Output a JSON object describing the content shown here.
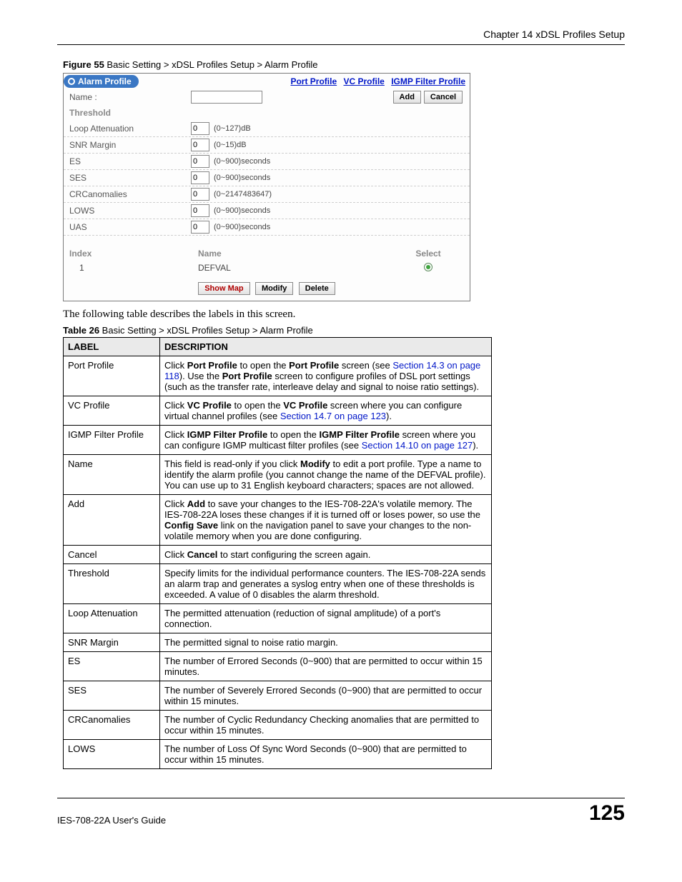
{
  "header": {
    "chapter": "Chapter 14 xDSL Profiles Setup"
  },
  "figure": {
    "label_bold": "Figure 55",
    "label_rest": "   Basic Setting > xDSL Profiles Setup > Alarm Profile"
  },
  "screenshot": {
    "title": "Alarm Profile",
    "links": {
      "port": "Port Profile",
      "vc": "VC Profile",
      "igmp": "IGMP Filter Profile"
    },
    "name_label": "Name :",
    "add_btn": "Add",
    "cancel_btn": "Cancel",
    "threshold_heading": "Threshold",
    "rows": [
      {
        "label": "Loop Attenuation",
        "value": "0",
        "hint": "(0~127)dB"
      },
      {
        "label": "SNR Margin",
        "value": "0",
        "hint": "(0~15)dB"
      },
      {
        "label": "ES",
        "value": "0",
        "hint": "(0~900)seconds"
      },
      {
        "label": "SES",
        "value": "0",
        "hint": "(0~900)seconds"
      },
      {
        "label": "CRCanomalies",
        "value": "0",
        "hint": "(0~2147483647)"
      },
      {
        "label": "LOWS",
        "value": "0",
        "hint": "(0~900)seconds"
      },
      {
        "label": "UAS",
        "value": "0",
        "hint": "(0~900)seconds"
      }
    ],
    "list_headers": {
      "index": "Index",
      "name": "Name",
      "select": "Select"
    },
    "list_row": {
      "index": "1",
      "name": "DEFVAL"
    },
    "bottom_btns": {
      "showmap": "Show Map",
      "modify": "Modify",
      "delete": "Delete"
    }
  },
  "body_text": "The following table describes the labels in this screen.",
  "table_caption": {
    "bold": "Table 26",
    "rest": "   Basic Setting > xDSL Profiles Setup > Alarm Profile"
  },
  "table": {
    "head": {
      "label": "LABEL",
      "desc": "DESCRIPTION"
    },
    "rows": [
      {
        "label": "Port Profile",
        "desc_pre": "Click ",
        "b1": "Port Profile",
        "desc_mid": " to open the ",
        "b2": "Port Profile",
        "desc_post": " screen (see ",
        "xref": "Section 14.3 on page 118",
        "tail": "). Use the ",
        "b3": "Port Profile",
        "tail2": " screen to configure profiles of DSL port settings (such as the transfer rate, interleave delay and signal to noise ratio settings)."
      },
      {
        "label": "VC Profile",
        "desc_pre": "Click ",
        "b1": "VC Profile",
        "desc_mid": " to open the ",
        "b2": "VC Profile",
        "desc_post": " screen where you can configure virtual channel profiles (see ",
        "xref": "Section 14.7 on page 123",
        "tail": ").",
        "b3": "",
        "tail2": ""
      },
      {
        "label": "IGMP Filter Profile",
        "desc_pre": "Click ",
        "b1": "IGMP Filter Profile",
        "desc_mid": " to open the ",
        "b2": "IGMP Filter Profile",
        "desc_post": " screen where you can configure IGMP multicast filter profiles (see ",
        "xref": "Section 14.10 on page 127",
        "tail": ").",
        "b3": "",
        "tail2": ""
      },
      {
        "label": "Name",
        "plain": "This field is read-only if you click ",
        "b1": "Modify",
        "plain2": " to edit a port profile. Type a name to identify the alarm profile (you cannot change the name of the DEFVAL profile). You can use up to 31 English keyboard characters; spaces are not allowed."
      },
      {
        "label": "Add",
        "plain": "Click ",
        "b1": "Add",
        "plain2": " to save your changes to the IES-708-22A's volatile memory. The IES-708-22A loses these changes if it is turned off or loses power, so use the ",
        "b2": "Config Save",
        "plain3": " link on the navigation panel to save your changes to the non-volatile memory when you are done configuring."
      },
      {
        "label": "Cancel",
        "plain": "Click ",
        "b1": "Cancel",
        "plain2": " to start configuring the screen again."
      },
      {
        "label": "Threshold",
        "plainonly": "Specify limits for the individual performance counters. The IES-708-22A sends an alarm trap and generates a syslog entry when one of these thresholds is exceeded. A value of 0 disables the alarm threshold."
      },
      {
        "label": "Loop Attenuation",
        "plainonly": "The permitted attenuation (reduction of signal amplitude) of a port's connection."
      },
      {
        "label": "SNR Margin",
        "plainonly": "The permitted signal to noise ratio margin."
      },
      {
        "label": "ES",
        "plainonly": "The number of Errored Seconds (0~900) that are permitted to occur within 15 minutes."
      },
      {
        "label": "SES",
        "plainonly": "The number of Severely Errored Seconds (0~900) that are permitted to occur within 15 minutes."
      },
      {
        "label": "CRCanomalies",
        "plainonly": "The number of Cyclic Redundancy Checking anomalies that are permitted to occur within 15 minutes."
      },
      {
        "label": "LOWS",
        "plainonly": "The number of Loss Of Sync Word Seconds (0~900) that are permitted to occur within 15 minutes."
      }
    ]
  },
  "footer": {
    "left": "IES-708-22A User's Guide",
    "right": "125"
  }
}
